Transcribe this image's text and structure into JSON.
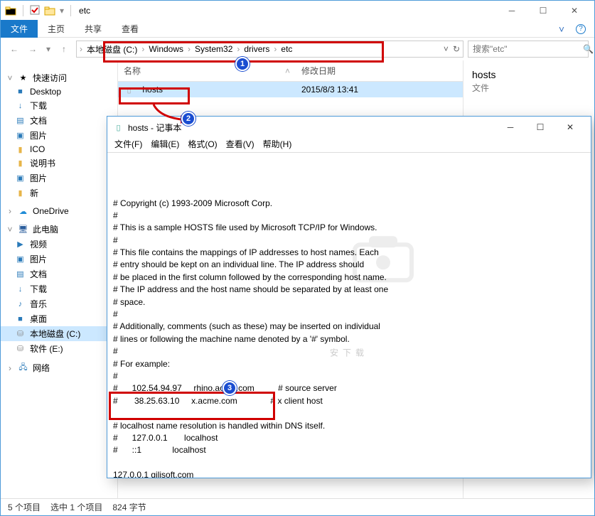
{
  "explorer": {
    "title": "etc",
    "tabs": {
      "file": "文件",
      "home": "主页",
      "share": "共享",
      "view": "查看"
    },
    "breadcrumbs": [
      "本地磁盘 (C:)",
      "Windows",
      "System32",
      "drivers",
      "etc"
    ],
    "search_placeholder": "搜索\"etc\"",
    "columns": {
      "name": "名称",
      "date": "修改日期"
    },
    "rows": [
      {
        "name": "hosts",
        "date": "2015/8/3 13:41",
        "selected": true
      }
    ],
    "details": {
      "name": "hosts",
      "type": "文件"
    },
    "status": {
      "count": "5 个项目",
      "selected": "选中 1 个项目",
      "size": "824 字节"
    }
  },
  "sidebar": {
    "quick": "快速访问",
    "items_quick": [
      "Desktop",
      "下载",
      "文档",
      "图片",
      "ICO",
      "说明书",
      "图片",
      "新"
    ],
    "onedrive": "OneDrive",
    "thispc": "此电脑",
    "items_pc": [
      "视频",
      "图片",
      "文档",
      "下载",
      "音乐",
      "桌面",
      "本地磁盘 (C:)",
      "软件 (E:)"
    ],
    "network": "网络"
  },
  "notepad": {
    "title": "hosts - 记事本",
    "menus": [
      "文件(F)",
      "编辑(E)",
      "格式(O)",
      "查看(V)",
      "帮助(H)"
    ],
    "content": "# Copyright (c) 1993-2009 Microsoft Corp.\n#\n# This is a sample HOSTS file used by Microsoft TCP/IP for Windows.\n#\n# This file contains the mappings of IP addresses to host names. Each\n# entry should be kept on an individual line. The IP address should\n# be placed in the first column followed by the corresponding host name.\n# The IP address and the host name should be separated by at least one\n# space.\n#\n# Additionally, comments (such as these) may be inserted on individual\n# lines or following the machine name denoted by a '#' symbol.\n#\n# For example:\n#\n#      102.54.94.97     rhino.acme.com          # source server\n#       38.25.63.10     x.acme.com              # x client host\n\n# localhost name resolution is handled within DNS itself.\n#\t127.0.0.1       localhost\n#\t::1             localhost\n\n127.0.0.1 gilisoft.com",
    "watermark": "安下载"
  },
  "markers": {
    "m1": "1",
    "m2": "2",
    "m3": "3"
  }
}
